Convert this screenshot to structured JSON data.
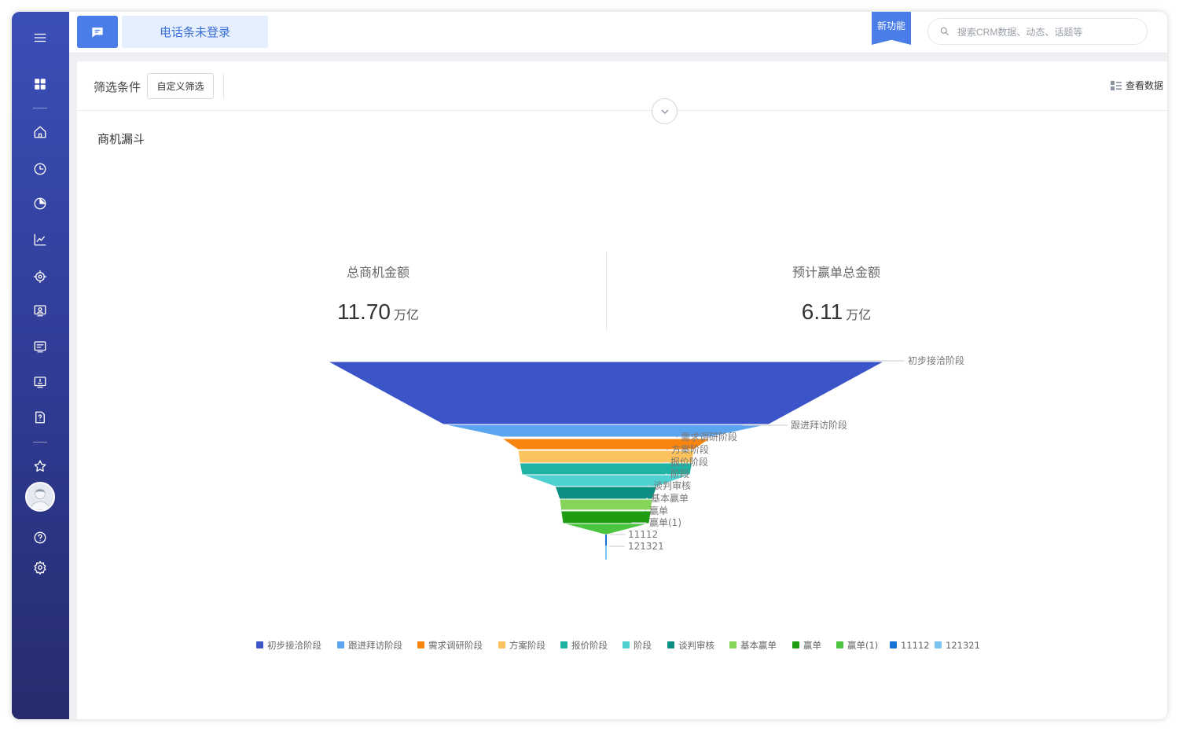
{
  "topbar": {
    "phone_status": "电话条未登录",
    "new_feature_badge": "新功能",
    "search_placeholder": "搜索CRM数据、动态、话题等"
  },
  "filter": {
    "label": "筛选条件",
    "custom_button": "自定义筛选",
    "view_data": "查看数据"
  },
  "panel": {
    "title": "商机漏斗"
  },
  "stats": {
    "total_label": "总商机金额",
    "total_value": "11.70",
    "total_unit": "万亿",
    "expected_label": "预计赢单总金额",
    "expected_value": "6.11",
    "expected_unit": "万亿"
  },
  "colors": {
    "sidebar": "#2f3a92",
    "accent": "#4a7de8"
  },
  "chart_data": {
    "type": "funnel",
    "stages": [
      {
        "name": "初步接洽阶段",
        "color": "#3b55c8",
        "share": 1.0
      },
      {
        "name": "跟进拜访阶段",
        "color": "#5ba4f0",
        "share": 0.585
      },
      {
        "name": "需求调研阶段",
        "color": "#f88510",
        "share": 0.374
      },
      {
        "name": "方案阶段",
        "color": "#fbc25e",
        "share": 0.316
      },
      {
        "name": "报价阶段",
        "color": "#1fb3a5",
        "share": 0.31
      },
      {
        "name": "阶段",
        "color": "#4fd1d1",
        "share": 0.302
      },
      {
        "name": "谈判审核",
        "color": "#0d8e83",
        "share": 0.183
      },
      {
        "name": "基本赢单",
        "color": "#86d45a",
        "share": 0.167
      },
      {
        "name": "赢单",
        "color": "#1e9c12",
        "share": 0.162
      },
      {
        "name": "赢单(1)",
        "color": "#4bc540",
        "share": 0.155
      },
      {
        "name": "11112",
        "color": "#1672d4",
        "share": 0.005
      },
      {
        "name": "121321",
        "color": "#7cc2ee",
        "share": 0.002
      }
    ],
    "legend": [
      {
        "name": "初步接洽阶段",
        "color": "#3b55c8"
      },
      {
        "name": "跟进拜访阶段",
        "color": "#5ba4f0"
      },
      {
        "name": "需求调研阶段",
        "color": "#f88510"
      },
      {
        "name": "方案阶段",
        "color": "#fbc25e"
      },
      {
        "name": "报价阶段",
        "color": "#1fb3a5"
      },
      {
        "name": "阶段",
        "color": "#4fd1d1"
      },
      {
        "name": "谈判审核",
        "color": "#0d8e83"
      },
      {
        "name": "基本赢单",
        "color": "#86d45a"
      },
      {
        "name": "赢单",
        "color": "#1e9c12"
      },
      {
        "name": "赢单(1)",
        "color": "#4bc540"
      },
      {
        "name": "11112",
        "color": "#1672d4"
      },
      {
        "name": "121321",
        "color": "#7cc2ee"
      }
    ]
  }
}
